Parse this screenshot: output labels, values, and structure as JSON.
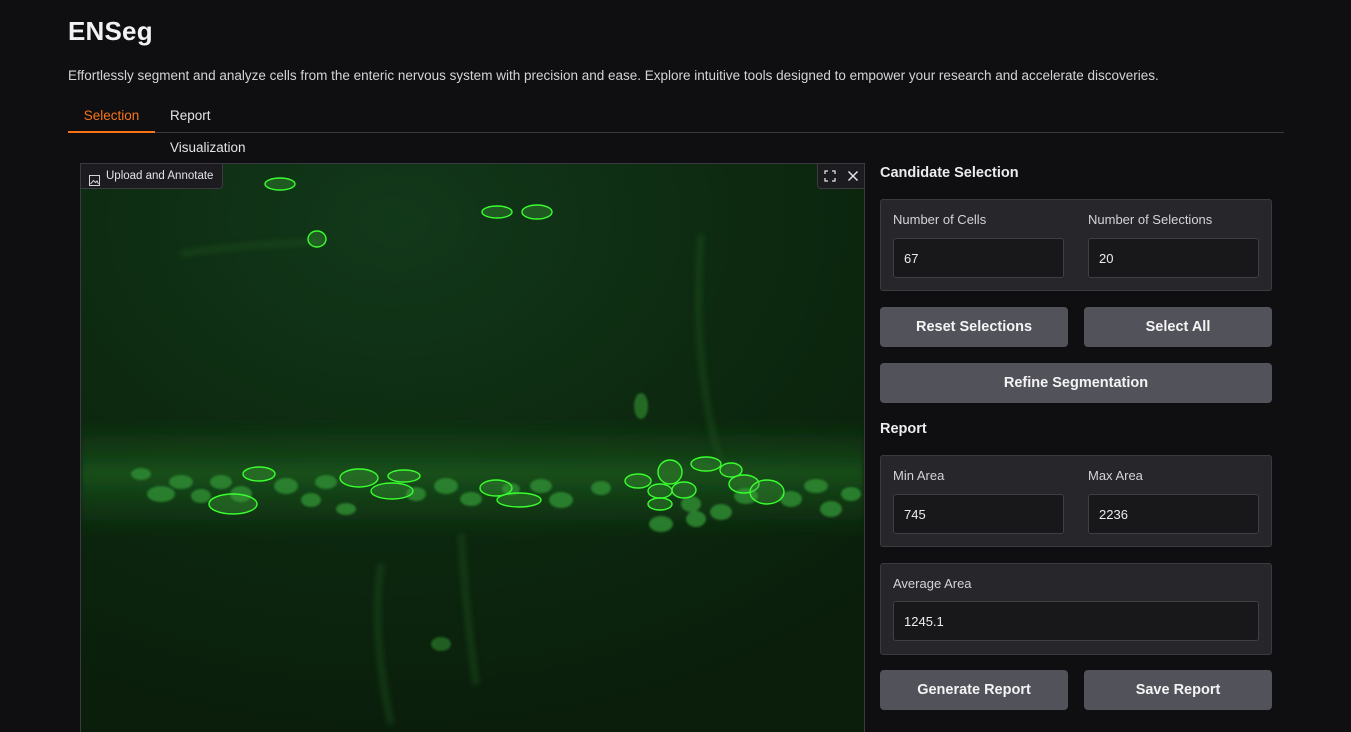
{
  "app": {
    "title": "ENSeg",
    "description": "Effortlessly segment and analyze cells from the enteric nervous system with precision and ease. Explore intuitive tools designed to empower your research and accelerate discoveries."
  },
  "tabs": [
    {
      "label": "Selection",
      "active": true
    },
    {
      "label": "Report Visualization",
      "active": false
    }
  ],
  "image_panel": {
    "label": "Upload and Annotate",
    "label_icon": "image-icon",
    "tools": [
      "fullscreen-icon",
      "close-icon"
    ]
  },
  "candidate_selection": {
    "title": "Candidate Selection",
    "number_of_cells": {
      "label": "Number of Cells",
      "value": "67"
    },
    "number_of_selections": {
      "label": "Number of Selections",
      "value": "20"
    },
    "reset_button": "Reset Selections",
    "select_all_button": "Select All",
    "refine_button": "Refine Segmentation"
  },
  "report": {
    "title": "Report",
    "min_area": {
      "label": "Min Area",
      "value": "745"
    },
    "max_area": {
      "label": "Max Area",
      "value": "2236"
    },
    "average_area": {
      "label": "Average Area",
      "value": "1245.1"
    },
    "generate_button": "Generate Report",
    "save_button": "Save Report"
  },
  "colors": {
    "accent": "#f97316",
    "button": "#52525b",
    "outline": "#39ff2e",
    "background": "#0f0f11"
  }
}
